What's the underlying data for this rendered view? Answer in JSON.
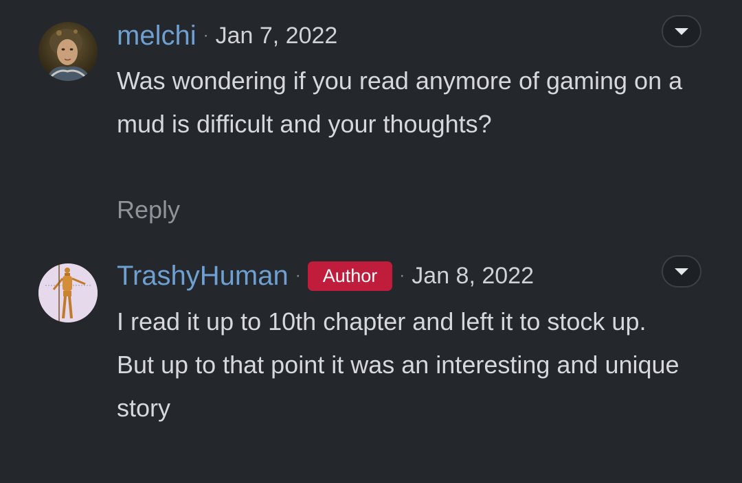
{
  "comments": [
    {
      "username": "melchi",
      "separator": "·",
      "date": "Jan 7, 2022",
      "badge": "",
      "text": "Was wondering if you read anymore of gaming on a mud is difficult and your thoughts?",
      "reply_label": "Reply",
      "avatar_icon": "portrait-avatar-icon",
      "menu_icon": "chevron-down-icon"
    },
    {
      "username": "TrashyHuman",
      "separator": "·",
      "badge": "Author",
      "date": "Jan 8, 2022",
      "text": "I read it up to 10th chapter and left it to stock up. But up to that point it was an interesting and unique story",
      "avatar_icon": "wooden-mannequin-avatar-icon",
      "menu_icon": "chevron-down-icon"
    }
  ],
  "colors": {
    "background": "#24272c",
    "username": "#6fa0d2",
    "badge": "#c01c3b",
    "body_text": "#d6d8db",
    "muted": "#8f949a"
  }
}
